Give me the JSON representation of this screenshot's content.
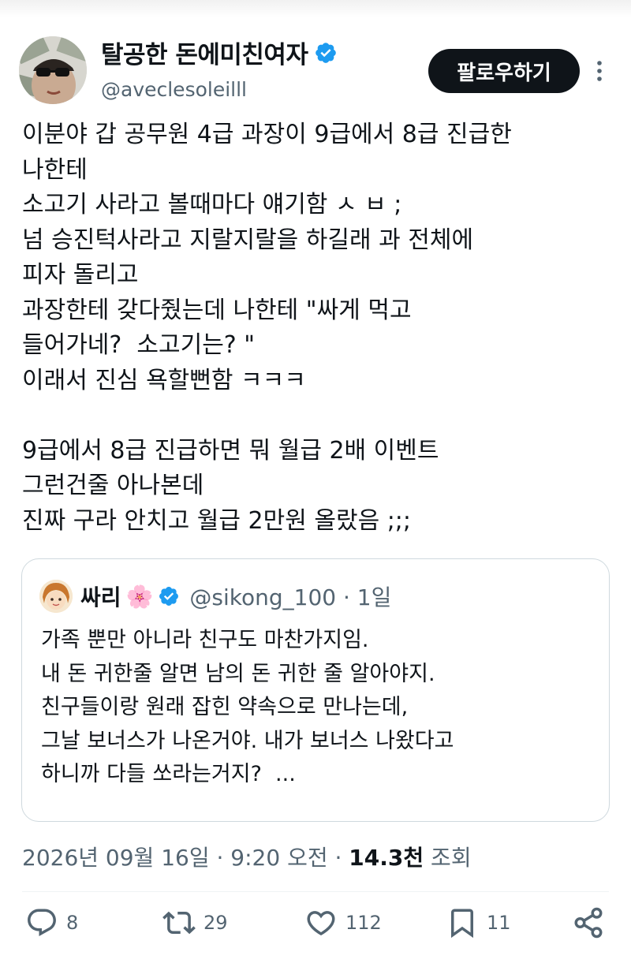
{
  "author": {
    "display_name": "탈공한 돈에미친여자",
    "handle": "@aveclesoleilll",
    "verified": true
  },
  "follow_button": {
    "label": "팔로우하기"
  },
  "tweet": {
    "text": "이분야 갑 공무원 4급 과장이 9급에서 8급 진급한\n나한테\n소고기 사라고 볼때마다 얘기함 ㅅ ㅂ ;\n넘 승진턱사라고 지랄지랄을 하길래 과 전체에\n피자 돌리고\n과장한테 갖다줬는데 나한테 \"싸게 먹고\n들어가네?  소고기는? \"\n이래서 진심 욕할뻔함 ㅋㅋㅋ\n\n9급에서 8급 진급하면 뭐 월급 2배 이벤트\n그런건줄 아나본데\n진짜 구라 안치고 월급 2만원 올랐음 ;;;"
  },
  "quote": {
    "name": "싸리",
    "emoji": "🌸",
    "handle": "@sikong_100 · 1일",
    "text": "가족 뿐만 아니라 친구도 마찬가지임.\n내 돈 귀한줄 알면 남의 돈 귀한 줄 알아야지.\n친구들이랑 원래 잡힌 약속으로 만나는데,\n그날 보너스가 나온거야. 내가 보너스 나왔다고\n하니까 다들 쏘라는거지?  ..."
  },
  "meta": {
    "date": "2026년 09월 16일 · 9:20 오전 · ",
    "views_count": "14.3천",
    "views_label": " 조회"
  },
  "actions": {
    "replies": "8",
    "retweets": "29",
    "likes": "112",
    "bookmarks": "11"
  },
  "icons": [
    "verified-badge-icon",
    "more-icon",
    "reply-icon",
    "retweet-icon",
    "like-icon",
    "bookmark-icon",
    "share-icon"
  ],
  "colors": {
    "verified": "#1d9bf0",
    "follow_bg": "#0f1419",
    "secondary_text": "#536471"
  }
}
